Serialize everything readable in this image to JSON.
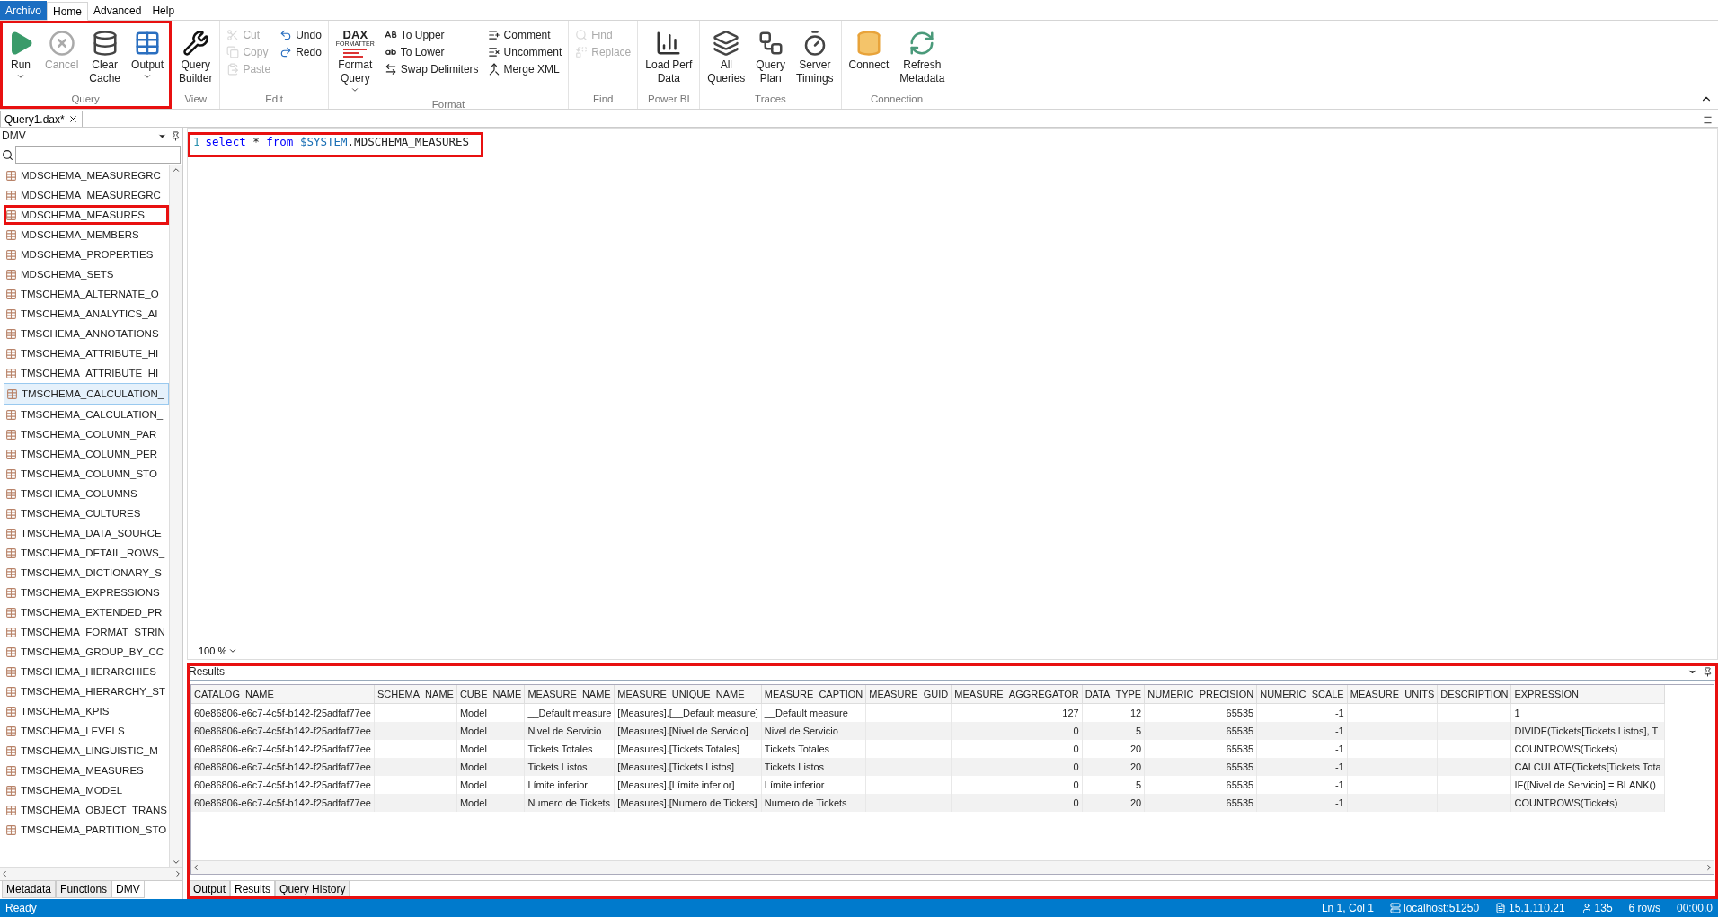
{
  "ribbon_tabs": [
    {
      "label": "Archivo",
      "kind": "file",
      "selected": false
    },
    {
      "label": "Home",
      "kind": "tab",
      "selected": true
    },
    {
      "label": "Advanced",
      "kind": "tab",
      "selected": false
    },
    {
      "label": "Help",
      "kind": "tab",
      "selected": false
    }
  ],
  "ribbon_groups": [
    {
      "label": "Query",
      "highlighted": true,
      "columns": [
        [
          {
            "lines": [
              "Run"
            ],
            "kind": "large",
            "dropdown": true,
            "disabled": false
          }
        ],
        [
          {
            "lines": [
              "Cancel"
            ],
            "kind": "large",
            "dropdown": false,
            "disabled": true
          }
        ],
        [
          {
            "lines": [
              "Clear",
              "Cache"
            ],
            "kind": "large",
            "dropdown": false,
            "disabled": false
          }
        ],
        [
          {
            "lines": [
              "Output"
            ],
            "kind": "large",
            "dropdown": true,
            "disabled": false
          }
        ]
      ]
    },
    {
      "label": "View",
      "highlighted": false,
      "columns": [
        [
          {
            "lines": [
              "Query",
              "Builder"
            ],
            "kind": "large",
            "dropdown": false,
            "disabled": false
          }
        ]
      ]
    },
    {
      "label": "Edit",
      "highlighted": false,
      "columns": [
        [
          {
            "lines": [
              "Cut"
            ],
            "kind": "small",
            "disabled": true
          },
          {
            "lines": [
              "Copy"
            ],
            "kind": "small",
            "disabled": true
          },
          {
            "lines": [
              "Paste"
            ],
            "kind": "small",
            "disabled": true
          }
        ],
        [
          {
            "lines": [
              "Undo"
            ],
            "kind": "small",
            "disabled": false
          },
          {
            "lines": [
              "Redo"
            ],
            "kind": "small",
            "disabled": false
          }
        ]
      ]
    },
    {
      "label": "Format",
      "highlighted": false,
      "columns": [
        [
          {
            "lines": [
              "Format",
              "Query"
            ],
            "kind": "logo",
            "logo": "DAX",
            "logo_sub": "FORMATTER",
            "dropdown": true,
            "disabled": false
          }
        ],
        [
          {
            "lines": [
              "To Upper"
            ],
            "kind": "small",
            "disabled": false
          },
          {
            "lines": [
              "To Lower"
            ],
            "kind": "small",
            "disabled": false
          },
          {
            "lines": [
              "Swap Delimiters"
            ],
            "kind": "small",
            "disabled": false
          }
        ],
        [
          {
            "lines": [
              "Comment"
            ],
            "kind": "small",
            "disabled": false
          },
          {
            "lines": [
              "Uncomment"
            ],
            "kind": "small",
            "disabled": false
          },
          {
            "lines": [
              "Merge XML"
            ],
            "kind": "small",
            "disabled": false
          }
        ]
      ]
    },
    {
      "label": "Find",
      "highlighted": false,
      "columns": [
        [
          {
            "lines": [
              "Find"
            ],
            "kind": "small",
            "disabled": true
          },
          {
            "lines": [
              "Replace"
            ],
            "kind": "small",
            "disabled": true
          }
        ]
      ]
    },
    {
      "label": "Power BI",
      "highlighted": false,
      "columns": [
        [
          {
            "lines": [
              "Load Perf",
              "Data"
            ],
            "kind": "large",
            "dropdown": false,
            "disabled": false
          }
        ]
      ]
    },
    {
      "label": "Traces",
      "highlighted": false,
      "columns": [
        [
          {
            "lines": [
              "All",
              "Queries"
            ],
            "kind": "large",
            "dropdown": false,
            "disabled": false
          }
        ],
        [
          {
            "lines": [
              "Query",
              "Plan"
            ],
            "kind": "large",
            "dropdown": false,
            "disabled": false
          }
        ],
        [
          {
            "lines": [
              "Server",
              "Timings"
            ],
            "kind": "large",
            "dropdown": false,
            "disabled": false
          }
        ]
      ]
    },
    {
      "label": "Connection",
      "highlighted": false,
      "columns": [
        [
          {
            "lines": [
              "Connect"
            ],
            "kind": "large",
            "dropdown": false,
            "disabled": false
          }
        ],
        [
          {
            "lines": [
              "Refresh",
              "Metadata"
            ],
            "kind": "large",
            "dropdown": false,
            "disabled": false
          }
        ]
      ]
    }
  ],
  "document_tabs": [
    {
      "label": "Query1.dax*",
      "selected": true
    }
  ],
  "dmv_panel": {
    "title": "DMV",
    "items": [
      {
        "label": "MDSCHEMA_MEASUREGRC",
        "selected": false,
        "highlighted": false
      },
      {
        "label": "MDSCHEMA_MEASUREGRC",
        "selected": false,
        "highlighted": false
      },
      {
        "label": "MDSCHEMA_MEASURES",
        "selected": false,
        "highlighted": true
      },
      {
        "label": "MDSCHEMA_MEMBERS",
        "selected": false,
        "highlighted": false
      },
      {
        "label": "MDSCHEMA_PROPERTIES",
        "selected": false,
        "highlighted": false
      },
      {
        "label": "MDSCHEMA_SETS",
        "selected": false,
        "highlighted": false
      },
      {
        "label": "TMSCHEMA_ALTERNATE_O",
        "selected": false,
        "highlighted": false
      },
      {
        "label": "TMSCHEMA_ANALYTICS_AI",
        "selected": false,
        "highlighted": false
      },
      {
        "label": "TMSCHEMA_ANNOTATIONS",
        "selected": false,
        "highlighted": false
      },
      {
        "label": "TMSCHEMA_ATTRIBUTE_HI",
        "selected": false,
        "highlighted": false
      },
      {
        "label": "TMSCHEMA_ATTRIBUTE_HI",
        "selected": false,
        "highlighted": false
      },
      {
        "label": "TMSCHEMA_CALCULATION_",
        "selected": true,
        "highlighted": false
      },
      {
        "label": "TMSCHEMA_CALCULATION_",
        "selected": false,
        "highlighted": false
      },
      {
        "label": "TMSCHEMA_COLUMN_PAR",
        "selected": false,
        "highlighted": false
      },
      {
        "label": "TMSCHEMA_COLUMN_PER",
        "selected": false,
        "highlighted": false
      },
      {
        "label": "TMSCHEMA_COLUMN_STO",
        "selected": false,
        "highlighted": false
      },
      {
        "label": "TMSCHEMA_COLUMNS",
        "selected": false,
        "highlighted": false
      },
      {
        "label": "TMSCHEMA_CULTURES",
        "selected": false,
        "highlighted": false
      },
      {
        "label": "TMSCHEMA_DATA_SOURCE",
        "selected": false,
        "highlighted": false
      },
      {
        "label": "TMSCHEMA_DETAIL_ROWS_",
        "selected": false,
        "highlighted": false
      },
      {
        "label": "TMSCHEMA_DICTIONARY_S",
        "selected": false,
        "highlighted": false
      },
      {
        "label": "TMSCHEMA_EXPRESSIONS",
        "selected": false,
        "highlighted": false
      },
      {
        "label": "TMSCHEMA_EXTENDED_PR",
        "selected": false,
        "highlighted": false
      },
      {
        "label": "TMSCHEMA_FORMAT_STRIN",
        "selected": false,
        "highlighted": false
      },
      {
        "label": "TMSCHEMA_GROUP_BY_CC",
        "selected": false,
        "highlighted": false
      },
      {
        "label": "TMSCHEMA_HIERARCHIES",
        "selected": false,
        "highlighted": false
      },
      {
        "label": "TMSCHEMA_HIERARCHY_ST",
        "selected": false,
        "highlighted": false
      },
      {
        "label": "TMSCHEMA_KPIS",
        "selected": false,
        "highlighted": false
      },
      {
        "label": "TMSCHEMA_LEVELS",
        "selected": false,
        "highlighted": false
      },
      {
        "label": "TMSCHEMA_LINGUISTIC_M",
        "selected": false,
        "highlighted": false
      },
      {
        "label": "TMSCHEMA_MEASURES",
        "selected": false,
        "highlighted": false
      },
      {
        "label": "TMSCHEMA_MODEL",
        "selected": false,
        "highlighted": false
      },
      {
        "label": "TMSCHEMA_OBJECT_TRANS",
        "selected": false,
        "highlighted": false
      },
      {
        "label": "TMSCHEMA_PARTITION_STO",
        "selected": false,
        "highlighted": false
      }
    ],
    "tabs": [
      {
        "label": "Metadata",
        "selected": false
      },
      {
        "label": "Functions",
        "selected": false
      },
      {
        "label": "DMV",
        "selected": true
      }
    ]
  },
  "editor": {
    "highlighted": true,
    "line_number": "1",
    "tokens": [
      {
        "text": "select",
        "kind": "keyword"
      },
      {
        "text": " * ",
        "kind": "plain"
      },
      {
        "text": "from",
        "kind": "keyword"
      },
      {
        "text": " $SYSTEM",
        "kind": "system"
      },
      {
        "text": ".MDSCHEMA_MEASURES",
        "kind": "plain"
      }
    ],
    "zoom": "100 %"
  },
  "results": {
    "title": "Results",
    "highlighted": true,
    "columns": [
      {
        "label": "CATALOG_NAME"
      },
      {
        "label": "SCHEMA_NAME"
      },
      {
        "label": "CUBE_NAME"
      },
      {
        "label": "MEASURE_NAME"
      },
      {
        "label": "MEASURE_UNIQUE_NAME"
      },
      {
        "label": "MEASURE_CAPTION"
      },
      {
        "label": "MEASURE_GUID"
      },
      {
        "label": "MEASURE_AGGREGATOR",
        "numeric": true
      },
      {
        "label": "DATA_TYPE",
        "numeric": true
      },
      {
        "label": "NUMERIC_PRECISION",
        "numeric": true
      },
      {
        "label": "NUMERIC_SCALE",
        "numeric": true
      },
      {
        "label": "MEASURE_UNITS"
      },
      {
        "label": "DESCRIPTION"
      },
      {
        "label": "EXPRESSION"
      }
    ],
    "rows": [
      [
        "60e86806-e6c7-4c5f-b142-f25adfaf77ee",
        null,
        "Model",
        "__Default measure",
        "[Measures].[__Default measure]",
        "__Default measure",
        null,
        "127",
        "12",
        "65535",
        "-1",
        null,
        null,
        "1"
      ],
      [
        "60e86806-e6c7-4c5f-b142-f25adfaf77ee",
        null,
        "Model",
        "Nivel de Servicio",
        "[Measures].[Nivel de Servicio]",
        "Nivel de Servicio",
        null,
        "0",
        "5",
        "65535",
        "-1",
        null,
        null,
        "DIVIDE(Tickets[Tickets Listos], T"
      ],
      [
        "60e86806-e6c7-4c5f-b142-f25adfaf77ee",
        null,
        "Model",
        "Tickets Totales",
        "[Measures].[Tickets Totales]",
        "Tickets Totales",
        null,
        "0",
        "20",
        "65535",
        "-1",
        null,
        null,
        "COUNTROWS(Tickets)"
      ],
      [
        "60e86806-e6c7-4c5f-b142-f25adfaf77ee",
        null,
        "Model",
        "Tickets Listos",
        "[Measures].[Tickets Listos]",
        "Tickets Listos",
        null,
        "0",
        "20",
        "65535",
        "-1",
        null,
        null,
        "CALCULATE(Tickets[Tickets Tota"
      ],
      [
        "60e86806-e6c7-4c5f-b142-f25adfaf77ee",
        null,
        "Model",
        "Límite inferior",
        "[Measures].[Límite inferior]",
        "Límite inferior",
        null,
        "0",
        "5",
        "65535",
        "-1",
        null,
        null,
        "IF([Nivel de Servicio] = BLANK()"
      ],
      [
        "60e86806-e6c7-4c5f-b142-f25adfaf77ee",
        null,
        "Model",
        "Numero de Tickets",
        "[Measures].[Numero de Tickets]",
        "Numero de Tickets",
        null,
        "0",
        "20",
        "65535",
        "-1",
        null,
        null,
        "COUNTROWS(Tickets)"
      ]
    ],
    "tabs": [
      {
        "label": "Output",
        "selected": false
      },
      {
        "label": "Results",
        "selected": true
      },
      {
        "label": "Query History",
        "selected": false
      }
    ]
  },
  "status_bar": {
    "message": "Ready",
    "position": "Ln 1, Col 1",
    "server": "localhost:51250",
    "version": "15.1.110.21",
    "spid": "135",
    "rows": "6 rows",
    "duration": "00:00.0"
  }
}
